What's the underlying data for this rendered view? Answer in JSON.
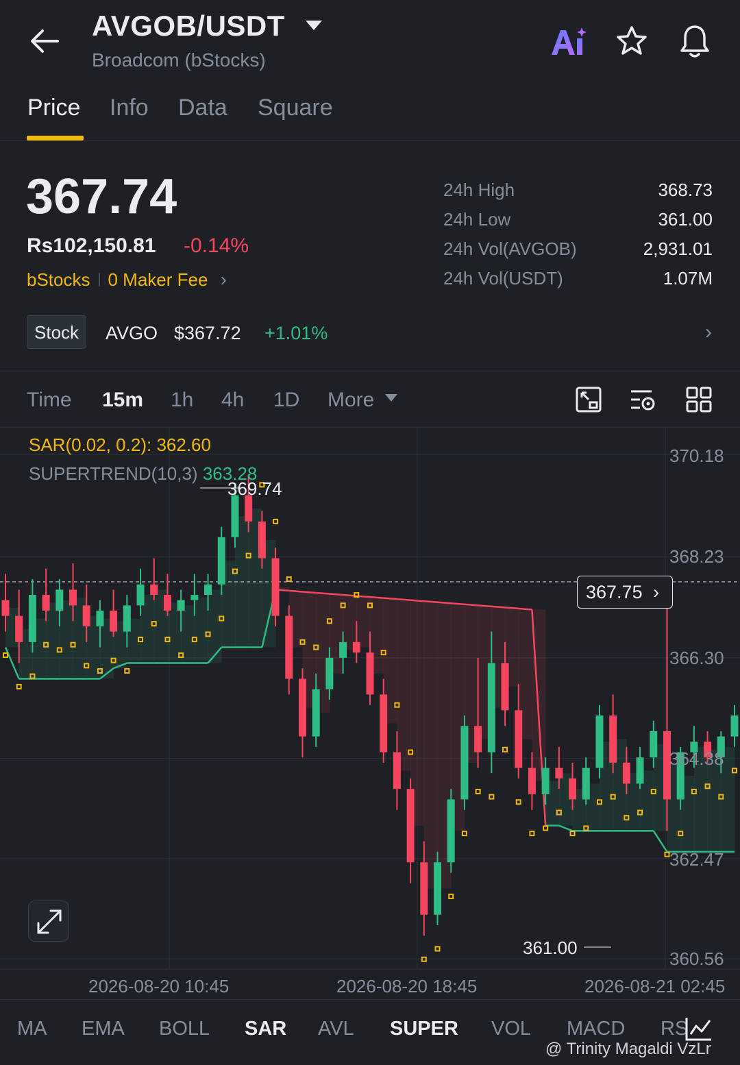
{
  "header": {
    "pair": "AVGOB/USDT",
    "subtitle": "Broadcom (bStocks)"
  },
  "tabs": [
    {
      "label": "Price",
      "active": true
    },
    {
      "label": "Info",
      "active": false
    },
    {
      "label": "Data",
      "active": false
    },
    {
      "label": "Square",
      "active": false
    }
  ],
  "price": {
    "last": "367.74",
    "fiat": "Rs102,150.81",
    "change": "-0.14%",
    "tag": "bStocks",
    "fee": "0 Maker Fee"
  },
  "stats": [
    {
      "label": "24h High",
      "value": "368.73"
    },
    {
      "label": "24h Low",
      "value": "361.00"
    },
    {
      "label": "24h Vol(AVGOB)",
      "value": "2,931.01"
    },
    {
      "label": "24h Vol(USDT)",
      "value": "1.07M"
    }
  ],
  "stock": {
    "badge": "Stock",
    "symbol": "AVGO",
    "price": "$367.72",
    "change": "+1.01%"
  },
  "intervals": {
    "time": "Time",
    "items": [
      "15m",
      "1h",
      "4h",
      "1D"
    ],
    "active": "15m",
    "more": "More"
  },
  "indicators": {
    "sar_label": "SAR(0.02, 0.2):",
    "sar_value": "362.60",
    "st_label": "SUPERTREND(10,3)",
    "st_value": "363.28"
  },
  "chart_data": {
    "type": "candlestick",
    "y_ticks": [
      "370.18",
      "368.23",
      "366.30",
      "364.38",
      "362.47",
      "360.56"
    ],
    "x_ticks": [
      "2026-08-20 10:45",
      "2026-08-20 18:45",
      "2026-08-21 02:45"
    ],
    "current_price": "367.75",
    "high_marker": "369.74",
    "low_marker": "361.00",
    "colors": {
      "up": "#2ebd85",
      "down": "#f6465d",
      "sar": "#f0b90b",
      "supertrend_up": "#2ebd85",
      "supertrend_down": "#f6465d"
    },
    "candles": [
      [
        367.4,
        367.9,
        366.8,
        367.1
      ],
      [
        367.1,
        367.6,
        366.2,
        366.6
      ],
      [
        366.6,
        367.8,
        366.4,
        367.5
      ],
      [
        367.5,
        368.0,
        367.0,
        367.2
      ],
      [
        367.2,
        367.8,
        366.9,
        367.6
      ],
      [
        367.6,
        368.1,
        367.0,
        367.3
      ],
      [
        367.3,
        367.7,
        366.6,
        366.9
      ],
      [
        366.9,
        367.4,
        366.5,
        367.2
      ],
      [
        367.2,
        367.6,
        366.7,
        366.8
      ],
      [
        366.8,
        367.5,
        366.5,
        367.3
      ],
      [
        367.3,
        368.0,
        367.1,
        367.7
      ],
      [
        367.7,
        368.2,
        367.4,
        367.5
      ],
      [
        367.5,
        367.9,
        367.1,
        367.2
      ],
      [
        367.2,
        367.6,
        366.8,
        367.4
      ],
      [
        367.4,
        367.9,
        367.1,
        367.5
      ],
      [
        367.5,
        367.9,
        367.2,
        367.7
      ],
      [
        367.7,
        368.8,
        367.5,
        368.6
      ],
      [
        368.6,
        369.6,
        368.4,
        369.4
      ],
      [
        369.4,
        369.8,
        368.7,
        368.9
      ],
      [
        368.9,
        369.1,
        368.0,
        368.2
      ],
      [
        368.2,
        368.4,
        366.9,
        367.1
      ],
      [
        367.1,
        367.3,
        365.6,
        365.9
      ],
      [
        365.9,
        366.1,
        364.4,
        364.8
      ],
      [
        364.8,
        366.0,
        364.6,
        365.7
      ],
      [
        365.7,
        366.5,
        365.5,
        366.3
      ],
      [
        366.3,
        366.8,
        366.0,
        366.6
      ],
      [
        366.6,
        367.0,
        366.2,
        366.4
      ],
      [
        366.4,
        366.8,
        365.4,
        365.6
      ],
      [
        365.6,
        365.9,
        364.3,
        364.5
      ],
      [
        364.5,
        364.9,
        363.4,
        363.8
      ],
      [
        363.8,
        364.0,
        362.0,
        362.4
      ],
      [
        362.4,
        362.8,
        361.0,
        361.4
      ],
      [
        361.4,
        362.6,
        361.2,
        362.4
      ],
      [
        362.4,
        363.8,
        362.2,
        363.6
      ],
      [
        363.6,
        365.2,
        363.4,
        365.0
      ],
      [
        365.0,
        366.3,
        364.2,
        364.5
      ],
      [
        364.5,
        366.8,
        364.1,
        366.2
      ],
      [
        366.2,
        366.6,
        365.0,
        365.3
      ],
      [
        365.3,
        365.8,
        364.0,
        364.2
      ],
      [
        364.2,
        364.5,
        363.4,
        363.7
      ],
      [
        363.7,
        364.4,
        363.5,
        364.2
      ],
      [
        364.2,
        364.6,
        363.8,
        364.0
      ],
      [
        364.0,
        364.3,
        363.4,
        363.6
      ],
      [
        363.6,
        364.4,
        363.5,
        364.2
      ],
      [
        364.2,
        365.4,
        364.0,
        365.2
      ],
      [
        365.2,
        365.6,
        364.1,
        364.3
      ],
      [
        364.3,
        364.6,
        363.7,
        363.9
      ],
      [
        363.9,
        364.6,
        363.8,
        364.4
      ],
      [
        364.4,
        365.1,
        364.2,
        364.9
      ],
      [
        364.9,
        367.6,
        363.0,
        363.6
      ],
      [
        363.6,
        364.6,
        363.4,
        364.5
      ],
      [
        364.5,
        365.0,
        364.2,
        364.7
      ],
      [
        364.7,
        364.9,
        364.3,
        364.4
      ],
      [
        364.4,
        364.9,
        364.1,
        364.8
      ],
      [
        364.8,
        365.4,
        364.6,
        365.2
      ]
    ]
  },
  "bottom_tabs": [
    {
      "label": "MA",
      "active": false
    },
    {
      "label": "EMA",
      "active": false
    },
    {
      "label": "BOLL",
      "active": false
    },
    {
      "label": "SAR",
      "active": true
    },
    {
      "label": "AVL",
      "active": false
    },
    {
      "label": "SUPER",
      "active": true
    },
    {
      "label": "VOL",
      "active": false
    },
    {
      "label": "MACD",
      "active": false
    },
    {
      "label": "RS",
      "active": false
    }
  ],
  "watermark": "@ Trinity Magaldi VzLr"
}
